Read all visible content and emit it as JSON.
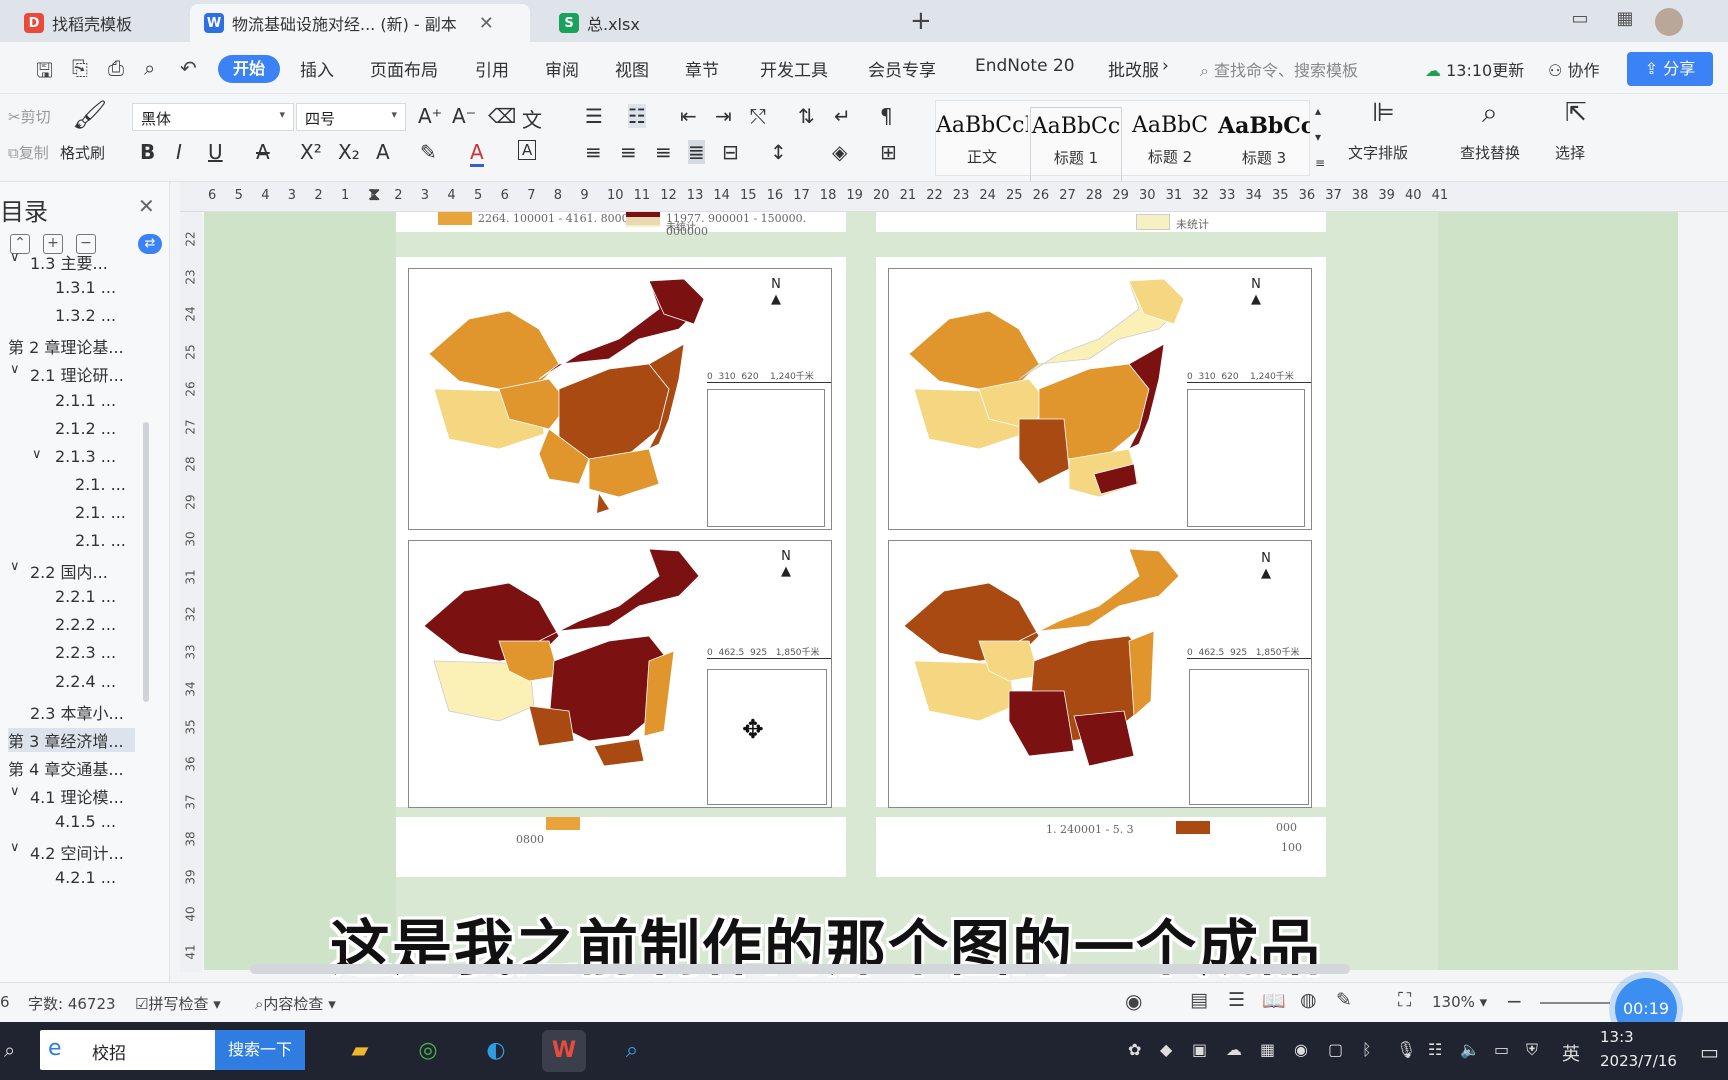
{
  "tabs": [
    {
      "label": "找稻壳模板",
      "icon_color": "#e84b3c",
      "icon_glyph": "D"
    },
    {
      "label": "物流基础设施对经... (新) - 副本",
      "icon_color": "#2f6fe4",
      "icon_glyph": "W"
    },
    {
      "label": "总.xlsx",
      "icon_color": "#1aa25a",
      "icon_glyph": "S"
    }
  ],
  "menubar": {
    "items": [
      "开始",
      "插入",
      "页面布局",
      "引用",
      "审阅",
      "视图",
      "章节",
      "开发工具",
      "会员专享",
      "EndNote 20",
      "批改服"
    ],
    "search_placeholder": "查找命令、搜索模板",
    "update_text": "13:10更新",
    "collab_text": "协作",
    "share_text": "分享"
  },
  "ribbon": {
    "cut_label": "剪切",
    "copy_label": "复制",
    "format_painter": "格式刷",
    "font_name": "黑体",
    "font_size": "四号",
    "styles": [
      {
        "sample": "AaBbCcI",
        "name": "正文"
      },
      {
        "sample": "AaBbCc",
        "name": "标题 1"
      },
      {
        "sample": "AaBbC",
        "name": "标题 2"
      },
      {
        "sample": "AaBbCcl",
        "name": "标题 3"
      }
    ],
    "text_layout": "文字排版",
    "find_replace": "查找替换",
    "select": "选择"
  },
  "ruler_numbers": [
    "6",
    "5",
    "4",
    "3",
    "2",
    "1",
    "1",
    "2",
    "3",
    "4",
    "5",
    "6",
    "7",
    "8",
    "9",
    "10",
    "11",
    "12",
    "13",
    "14",
    "15",
    "16",
    "17",
    "18",
    "19",
    "20",
    "21",
    "22",
    "23",
    "24",
    "25",
    "26",
    "27",
    "28",
    "29",
    "30",
    "31",
    "32",
    "33",
    "34",
    "35",
    "36",
    "37",
    "38",
    "39",
    "40",
    "41"
  ],
  "vruler_numbers": [
    "22",
    "23",
    "24",
    "25",
    "26",
    "27",
    "28",
    "29",
    "30",
    "31",
    "32",
    "33",
    "34",
    "35",
    "36",
    "37",
    "38",
    "39",
    "40",
    "41"
  ],
  "toc": {
    "title": "目录",
    "items": [
      {
        "label": "1.3 主要...",
        "level": 1
      },
      {
        "label": "1.3.1 ...",
        "level": 2
      },
      {
        "label": "1.3.2 ...",
        "level": 2
      },
      {
        "label": "第 2 章理论基...",
        "level": 0
      },
      {
        "label": "2.1 理论研...",
        "level": 1
      },
      {
        "label": "2.1.1 ...",
        "level": 2
      },
      {
        "label": "2.1.2 ...",
        "level": 2
      },
      {
        "label": "2.1.3 ...",
        "level": 2
      },
      {
        "label": "2.1. ...",
        "level": 3
      },
      {
        "label": "2.1. ...",
        "level": 3
      },
      {
        "label": "2.1. ...",
        "level": 3
      },
      {
        "label": "2.2 国内...",
        "level": 1
      },
      {
        "label": "2.2.1 ...",
        "level": 2
      },
      {
        "label": "2.2.2 ...",
        "level": 2
      },
      {
        "label": "2.2.3 ...",
        "level": 2
      },
      {
        "label": "2.2.4 ...",
        "level": 2
      },
      {
        "label": "2.3 本章小...",
        "level": 1
      },
      {
        "label": "第 3 章经济增...",
        "level": 0
      },
      {
        "label": "第 4 章交通基...",
        "level": 0
      },
      {
        "label": "4.1 理论模...",
        "level": 1
      },
      {
        "label": "4.1.5 ...",
        "level": 2
      },
      {
        "label": "4.2 空间计...",
        "level": 1
      },
      {
        "label": "4.2.1 ...",
        "level": 2
      }
    ]
  },
  "document": {
    "legend_top": [
      {
        "text": "2264. 100001 - 4161. 800000",
        "color": "#e8a33a"
      },
      {
        "text": "11977. 900001 - 150000. 000000",
        "color": "#7a1010"
      },
      {
        "text": "未统计",
        "color": "#f6f0c2"
      }
    ],
    "legend_top_right": [
      {
        "text": "未统计",
        "color": "#f6f0c2"
      }
    ],
    "map_north_label": "N",
    "scale_a": [
      "0",
      "310",
      "620",
      "1,240",
      "千米"
    ],
    "scale_b": [
      "0",
      "462.5",
      "925",
      "1,850",
      "千米"
    ],
    "legend_bottom_left": "0800",
    "legend_bottom_right": [
      "1. 240001 - 5. 3",
      "000",
      "100"
    ],
    "colors": {
      "dark": "#7b1111",
      "brown": "#a94a13",
      "orange": "#e0952d",
      "light": "#f5d681",
      "pale": "#fbf0b6"
    }
  },
  "subtitle": "这是我之前制作的那个图的一个成品",
  "statusbar": {
    "page_num": "6",
    "word_count": "字数: 46723",
    "spell_check": "拼写检查",
    "content_check": "内容检查",
    "zoom": "130%",
    "timer": "00:19"
  },
  "taskbar": {
    "search_text": "校招",
    "search_button": "搜索一下",
    "ime": "英",
    "time": "13:3",
    "date": "2023/7/16"
  }
}
